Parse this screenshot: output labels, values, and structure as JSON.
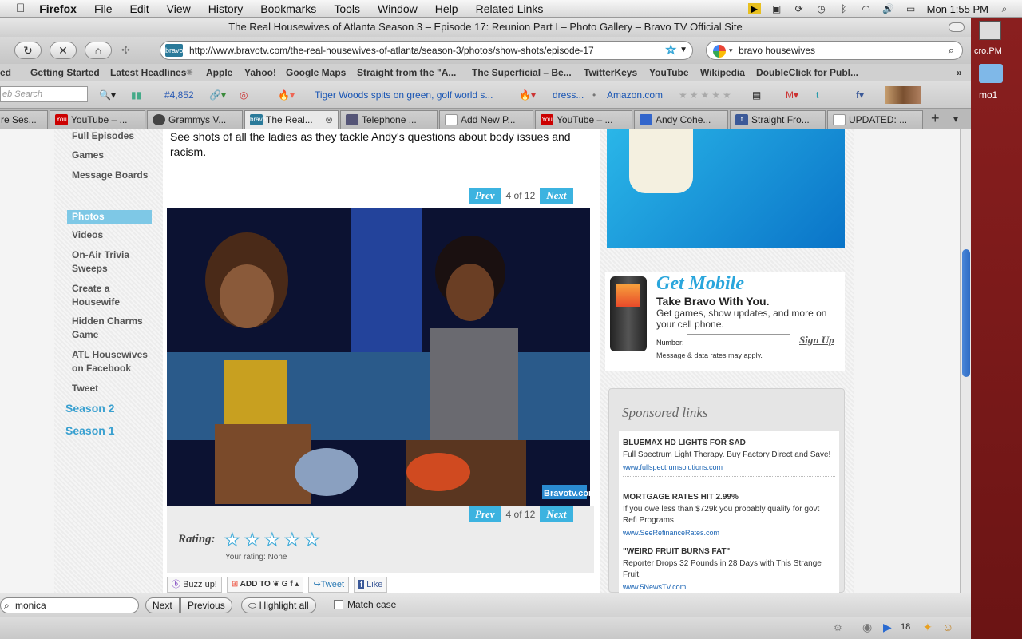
{
  "menubar": {
    "apple": "",
    "items": [
      "Firefox",
      "File",
      "Edit",
      "View",
      "History",
      "Bookmarks",
      "Tools",
      "Window",
      "Help",
      "Related Links"
    ],
    "clock": "Mon 1:55 PM"
  },
  "window": {
    "title": "The Real Housewives of Atlanta Season 3 – Episode 17: Reunion Part I – Photo Gallery – Bravo TV Official Site"
  },
  "navbar": {
    "url": "http://www.bravotv.com/the-real-housewives-of-atlanta/season-3/photos/show-shots/episode-17",
    "search_value": "bravo housewives"
  },
  "bookmarks": [
    "ed",
    "Getting Started",
    "Latest Headlines",
    "Apple",
    "Yahoo!",
    "Google Maps",
    "Straight from the \"A...",
    "The Superficial – Be...",
    "TwitterKeys",
    "YouTube",
    "Wikipedia",
    "DoubleClick for Publ..."
  ],
  "addonbar": {
    "search_placeholder": "eb Search",
    "count": "#4,852",
    "news": "Tiger Woods spits on green, golf world s...",
    "item": "dress...",
    "amazon": "Amazon.com"
  },
  "tabs": [
    {
      "label": "re Ses...",
      "icon": ""
    },
    {
      "label": "YouTube – ...",
      "icon": "You"
    },
    {
      "label": "Grammys V...",
      "icon": ""
    },
    {
      "label": "The Real...",
      "icon": "bravo"
    },
    {
      "label": "Telephone ...",
      "icon": ""
    },
    {
      "label": "Add New P...",
      "icon": ""
    },
    {
      "label": "YouTube – ...",
      "icon": "You"
    },
    {
      "label": "Andy Cohe...",
      "icon": ""
    },
    {
      "label": "Straight Fro...",
      "icon": "f"
    },
    {
      "label": "UPDATED: ...",
      "icon": ""
    }
  ],
  "sidenav": {
    "items": [
      "Full Episodes",
      "Games",
      "Message Boards",
      "Photos",
      "Videos",
      "On-Air Trivia Sweeps",
      "Create a Housewife",
      "Hidden Charms Game",
      "ATL Housewives on Facebook",
      "Tweet"
    ],
    "seasons": [
      "Season 2",
      "Season 1"
    ]
  },
  "main": {
    "caption": "See shots of all the ladies as they tackle Andy's questions about body issues and racism.",
    "prev": "Prev",
    "next": "Next",
    "counter": "4 of 12",
    "watermark": "Bravotv.com",
    "rating_label": "Rating:",
    "your_rating": "Your rating: None",
    "share": {
      "buzz": "Buzz up!",
      "addto": "ADD TO",
      "tweet": "Tweet",
      "like": "Like"
    }
  },
  "mobile": {
    "title": "Get Mobile",
    "subtitle": "Take Bravo With You.",
    "desc": "Get games, show updates, and more on your cell phone.",
    "number_label": "Number:",
    "signup": "Sign Up",
    "fine": "Message & data rates may apply."
  },
  "sponsored": {
    "heading": "Sponsored links",
    "ads": [
      {
        "title": "BLUEMAX HD LIGHTS FOR SAD",
        "body": "Full Spectrum Light Therapy. Buy Factory Direct and Save!",
        "url": "www.fullspectrumsolutions.com"
      },
      {
        "title": "MORTGAGE RATES HIT 2.99%",
        "body": "If you owe less than $729k you probably qualify for govt Refi Programs",
        "url": "www.SeeRefinanceRates.com"
      },
      {
        "title": "\"WEIRD FRUIT BURNS FAT\"",
        "body": "Reporter Drops 32 Pounds in 28 Days with This Strange Fruit.",
        "url": "www.5NewsTV.com"
      }
    ]
  },
  "findbar": {
    "value": "monica",
    "next": "Next",
    "previous": "Previous",
    "highlight": "Highlight all",
    "match_case": "Match case"
  },
  "statusbar": {
    "count": "18"
  },
  "desktop": {
    "label1": "cro.PM",
    "label2": "mo1"
  }
}
